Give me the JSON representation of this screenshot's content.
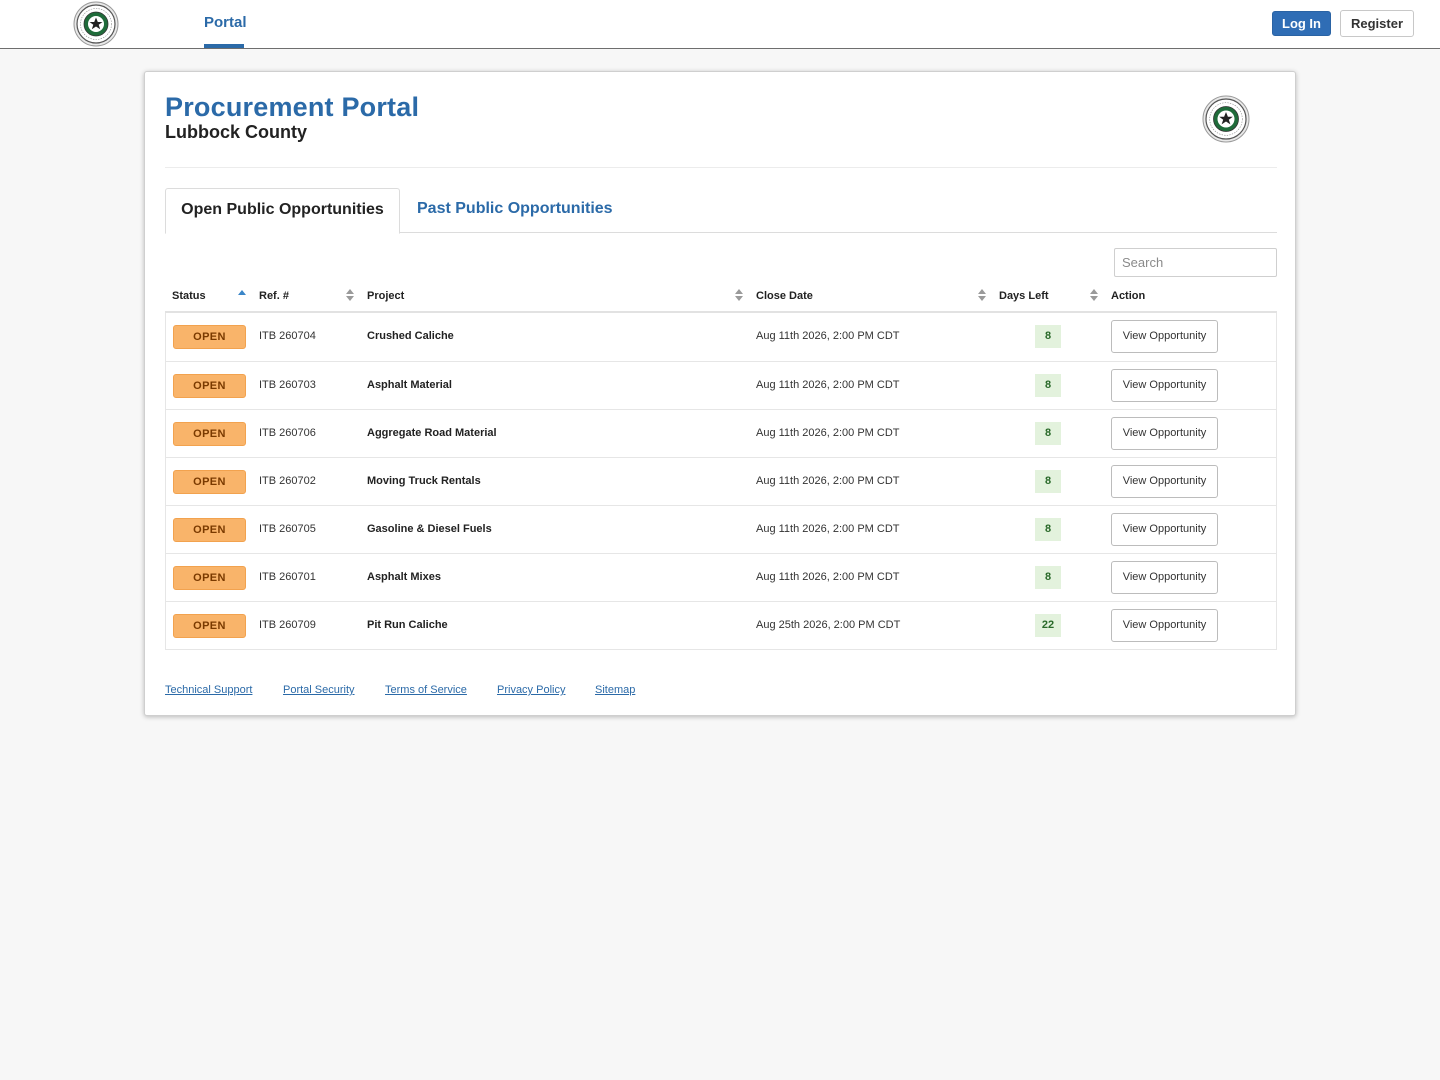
{
  "nav": {
    "portal_label": "Portal",
    "login_label": "Log In",
    "register_label": "Register"
  },
  "header": {
    "title": "Procurement Portal",
    "subtitle": "Lubbock County"
  },
  "tabs": [
    {
      "label": "Open Public Opportunities",
      "active": true
    },
    {
      "label": "Past Public Opportunities",
      "active": false
    }
  ],
  "search": {
    "placeholder": "Search",
    "value": ""
  },
  "table": {
    "columns": [
      "Status",
      "Ref. #",
      "Project",
      "Close Date",
      "Days Left",
      "Action"
    ],
    "rows": [
      {
        "status": "OPEN",
        "ref": "ITB 260704",
        "project": "Crushed Caliche",
        "close_date": "Aug 11th 2026, 2:00 PM CDT",
        "days_left": "8",
        "action": "View Opportunity"
      },
      {
        "status": "OPEN",
        "ref": "ITB 260703",
        "project": "Asphalt Material",
        "close_date": "Aug 11th 2026, 2:00 PM CDT",
        "days_left": "8",
        "action": "View Opportunity"
      },
      {
        "status": "OPEN",
        "ref": "ITB 260706",
        "project": "Aggregate Road Material",
        "close_date": "Aug 11th 2026, 2:00 PM CDT",
        "days_left": "8",
        "action": "View Opportunity"
      },
      {
        "status": "OPEN",
        "ref": "ITB 260702",
        "project": "Moving Truck Rentals",
        "close_date": "Aug 11th 2026, 2:00 PM CDT",
        "days_left": "8",
        "action": "View Opportunity"
      },
      {
        "status": "OPEN",
        "ref": "ITB 260705",
        "project": "Gasoline & Diesel Fuels",
        "close_date": "Aug 11th 2026, 2:00 PM CDT",
        "days_left": "8",
        "action": "View Opportunity"
      },
      {
        "status": "OPEN",
        "ref": "ITB 260701",
        "project": "Asphalt Mixes",
        "close_date": "Aug 11th 2026, 2:00 PM CDT",
        "days_left": "8",
        "action": "View Opportunity"
      },
      {
        "status": "OPEN",
        "ref": "ITB 260709",
        "project": "Pit Run Caliche",
        "close_date": "Aug 25th 2026, 2:00 PM CDT",
        "days_left": "22",
        "action": "View Opportunity"
      }
    ]
  },
  "footer": {
    "links": [
      "Technical Support",
      "Portal Security",
      "Terms of Service",
      "Privacy Policy",
      "Sitemap"
    ]
  },
  "colors": {
    "brand_blue": "#2b6aa8",
    "login_button": "#2f6db5",
    "open_badge": "#f9b46a",
    "days_badge": "#e3f2dd",
    "seal_green": "#1f6b3a"
  }
}
